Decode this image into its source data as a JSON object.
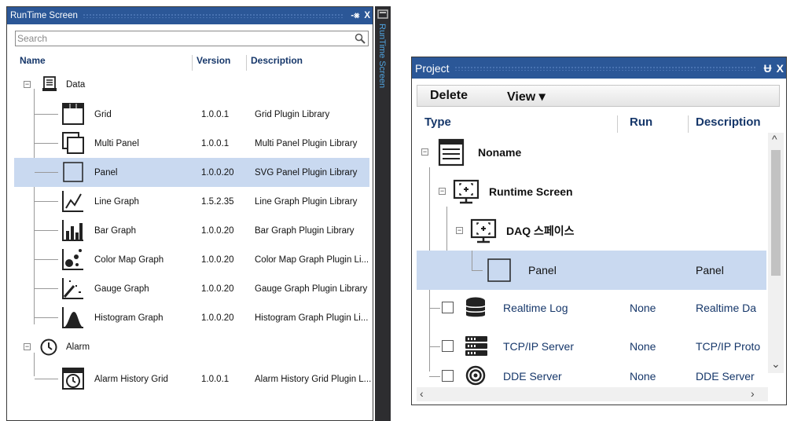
{
  "runtime_panel": {
    "title": "RunTime Screen",
    "title_buttons": [
      "-⨳",
      "✕"
    ],
    "pin_label": "▣",
    "close_label": "X",
    "side_tab": "RunTime Screen",
    "search_placeholder": "Search",
    "columns": {
      "name": "Name",
      "version": "Version",
      "description": "Description"
    },
    "groups": [
      {
        "label": "Data",
        "icon": "data-document-icon"
      },
      {
        "label": "Alarm",
        "icon": "clock-icon"
      }
    ],
    "items": [
      {
        "name": "Grid",
        "version": "1.0.0.1",
        "description": "Grid Plugin Library",
        "icon": "grid-icon"
      },
      {
        "name": "Multi Panel",
        "version": "1.0.0.1",
        "description": "Multi Panel Plugin Library",
        "icon": "multi-panel-icon"
      },
      {
        "name": "Panel",
        "version": "1.0.0.20",
        "description": "SVG Panel Plugin Library",
        "icon": "panel-icon"
      },
      {
        "name": "Line Graph",
        "version": "1.5.2.35",
        "description": "Line Graph Plugin Library",
        "icon": "line-graph-icon"
      },
      {
        "name": "Bar Graph",
        "version": "1.0.0.20",
        "description": "Bar Graph Plugin Library",
        "icon": "bar-graph-icon"
      },
      {
        "name": "Color Map Graph",
        "version": "1.0.0.20",
        "description": "Color Map Graph Plugin Li...",
        "icon": "color-map-icon"
      },
      {
        "name": "Gauge Graph",
        "version": "1.0.0.20",
        "description": "Gauge Graph Plugin Library",
        "icon": "gauge-icon"
      },
      {
        "name": "Histogram Graph",
        "version": "1.0.0.20",
        "description": "Histogram Graph Plugin Li...",
        "icon": "histogram-icon"
      },
      {
        "name": "Alarm History Grid",
        "version": "1.0.0.1",
        "description": "Alarm History Grid Plugin L...",
        "icon": "alarm-grid-icon"
      }
    ]
  },
  "project_panel": {
    "title": "Project",
    "pin_label": "Ʉ",
    "close_label": "X",
    "toolbar": {
      "delete_label": "Delete",
      "view_label": "View ▾"
    },
    "columns": {
      "type": "Type",
      "run": "Run",
      "description": "Description"
    },
    "rows": [
      {
        "type": "Noname",
        "run": "",
        "description": "",
        "icon": "document-list-icon"
      },
      {
        "type": "Runtime Screen",
        "run": "",
        "description": "",
        "icon": "monitor-icon"
      },
      {
        "type": "DAQ 스페이스",
        "run": "",
        "description": "",
        "icon": "monitor-icon"
      },
      {
        "type": "Panel",
        "run": "",
        "description": "Panel",
        "icon": "panel-icon"
      },
      {
        "type": "Realtime Log",
        "run": "None",
        "description": "Realtime Da",
        "icon": "database-icon"
      },
      {
        "type": "TCP/IP Server",
        "run": "None",
        "description": "TCP/IP Proto",
        "icon": "server-icon"
      },
      {
        "type": "DDE Server",
        "run": "None",
        "description": "DDE Server",
        "icon": "dde-signal-icon"
      }
    ]
  },
  "colors": {
    "titlebar": "#2b5797",
    "selection": "#c9d9f0",
    "header_text": "#16376a",
    "dark_strip": "#2d2d30"
  }
}
